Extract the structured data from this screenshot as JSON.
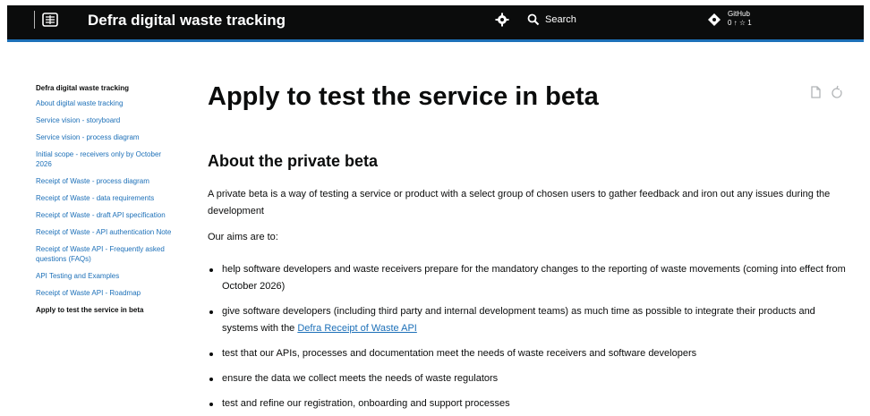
{
  "header": {
    "title": "Defra digital waste tracking",
    "search_label": "Search",
    "github_title": "GitHub",
    "github_stats": "0 ↑ ☆ 1"
  },
  "sidebar": {
    "heading": "Defra digital waste tracking",
    "items": [
      {
        "label": "About digital waste tracking"
      },
      {
        "label": "Service vision - storyboard"
      },
      {
        "label": "Service vision - process diagram"
      },
      {
        "label": "Initial scope - receivers only by October 2026"
      },
      {
        "label": "Receipt of Waste - process diagram"
      },
      {
        "label": "Receipt of Waste - data requirements"
      },
      {
        "label": "Receipt of Waste - draft API specification"
      },
      {
        "label": "Receipt of Waste - API authentication Note"
      },
      {
        "label": "Receipt of Waste API - Frequently asked questions (FAQs)"
      },
      {
        "label": "API Testing and Examples"
      },
      {
        "label": "Receipt of Waste API - Roadmap"
      },
      {
        "label": "Apply to test the service in beta"
      }
    ]
  },
  "main": {
    "title": "Apply to test the service in beta",
    "section_title": "About the private beta",
    "intro": "A private beta is a way of testing a service or product with a select group of chosen users to gather feedback and iron out any issues during the development",
    "aims_lead": "Our aims are to:",
    "bullets": [
      {
        "text": "help software developers and waste receivers prepare for the mandatory changes to the reporting of waste movements (coming into effect from October 2026)"
      },
      {
        "text_before": "give software developers (including third party and internal development teams) as much time as possible to integrate their products and systems with the ",
        "link": "Defra Receipt of Waste API"
      },
      {
        "text": "test that our APIs, processes and documentation meet the needs of waste receivers and software developers"
      },
      {
        "text": "ensure the data we collect meets the needs of waste regulators"
      },
      {
        "text": "test and refine our registration, onboarding and support processes"
      }
    ]
  },
  "colors": {
    "header_bg": "#0b0c0c",
    "accent_bar": "#1d70b8",
    "link": "#1d70b8",
    "text": "#0b0c0c"
  },
  "icons": {
    "crest": "royal-crest-icon",
    "settings": "gear-icon",
    "search": "search-icon",
    "github": "github-icon",
    "tools": [
      "copy-page-icon",
      "refresh-icon"
    ]
  }
}
